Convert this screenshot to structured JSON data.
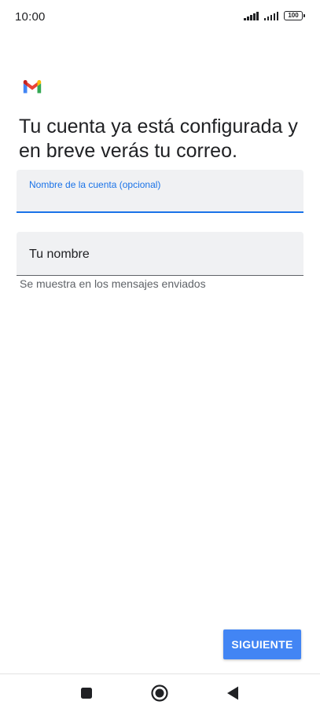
{
  "status_bar": {
    "time": "10:00",
    "battery_level": "100",
    "icons": [
      "signal-icon",
      "signal-icon",
      "battery-icon"
    ]
  },
  "app": {
    "logo_icon": "gmail-logo-icon"
  },
  "heading": "Tu cuenta ya está configurada y en breve verás tu correo.",
  "account_name_field": {
    "label": "Nombre de la cuenta (opcional)",
    "value": ""
  },
  "your_name_field": {
    "placeholder": "Tu nombre",
    "value": "",
    "helper_text": "Se muestra en los mensajes enviados"
  },
  "next_button": {
    "label": "SIGUIENTE"
  },
  "nav_bar": {
    "icons": [
      "recents-icon",
      "home-icon",
      "back-icon"
    ]
  },
  "colors": {
    "accent": "#1a73e8",
    "button": "#4285f4",
    "field_background": "#f0f1f3",
    "text": "#202124",
    "secondary_text": "#5f6368"
  }
}
